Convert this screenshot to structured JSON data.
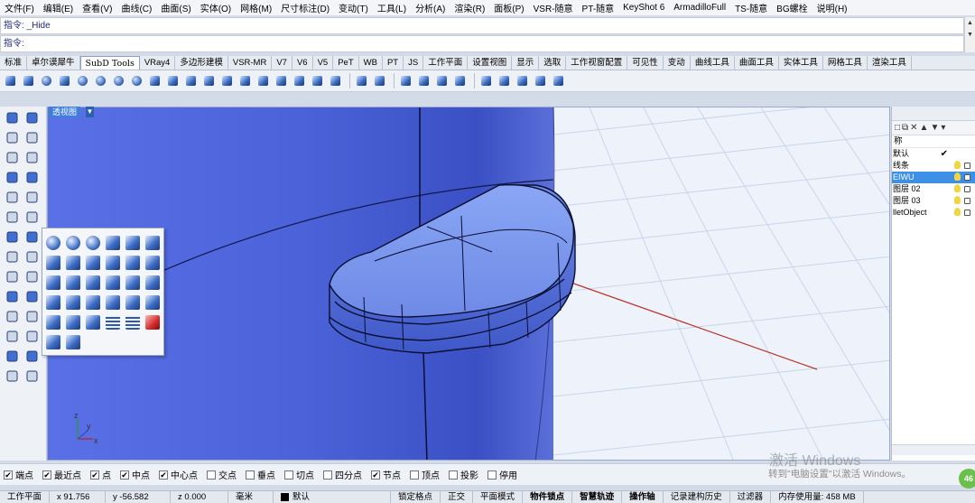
{
  "menu": [
    "文件(F)",
    "编辑(E)",
    "查看(V)",
    "曲线(C)",
    "曲面(S)",
    "实体(O)",
    "网格(M)",
    "尺寸标注(D)",
    "变动(T)",
    "工具(L)",
    "分析(A)",
    "渲染(R)",
    "面板(P)",
    "VSR-随意",
    "PT-随意",
    "KeyShot 6",
    "ArmadilloFull",
    "TS-随意",
    "BG螺栓",
    "说明(H)"
  ],
  "command": {
    "history": "指令: _Hide",
    "prompt": "指令:"
  },
  "tabs": [
    "标准",
    "卓尔谟犀牛",
    "SubD Tools",
    "VRay4",
    "多边形建模",
    "VSR-MR",
    "V7",
    "V6",
    "V5",
    "PeT",
    "WB",
    "PT",
    "JS",
    "工作平面",
    "设置视图",
    "显示",
    "选取",
    "工作视窗配置",
    "可见性",
    "变动",
    "曲线工具",
    "曲面工具",
    "实体工具",
    "网格工具",
    "渲染工具"
  ],
  "active_tab": "SubD Tools",
  "viewport": {
    "title": "透视图",
    "axis_x": "x",
    "axis_y": "y",
    "axis_z": "z"
  },
  "layers_panel": {
    "column_header": "称",
    "rows": [
      {
        "name": "默认",
        "current": true,
        "selected": false
      },
      {
        "name": "线条",
        "current": false,
        "selected": false
      },
      {
        "name": "EIWU",
        "current": false,
        "selected": true
      },
      {
        "name": "图层 02",
        "current": false,
        "selected": false
      },
      {
        "name": "图层 03",
        "current": false,
        "selected": false
      },
      {
        "name": "lletObject",
        "current": false,
        "selected": false
      }
    ],
    "current_mark": "✔"
  },
  "osnap": [
    {
      "label": "端点",
      "checked": true
    },
    {
      "label": "最近点",
      "checked": true
    },
    {
      "label": "点",
      "checked": true
    },
    {
      "label": "中点",
      "checked": true
    },
    {
      "label": "中心点",
      "checked": true
    },
    {
      "label": "交点",
      "checked": false
    },
    {
      "label": "垂点",
      "checked": false
    },
    {
      "label": "切点",
      "checked": false
    },
    {
      "label": "四分点",
      "checked": false
    },
    {
      "label": "节点",
      "checked": true
    },
    {
      "label": "顶点",
      "checked": false
    },
    {
      "label": "投影",
      "checked": false
    },
    {
      "label": "停用",
      "checked": false
    }
  ],
  "status": {
    "cplane": "工作平面",
    "x": "x 91.756",
    "y": "y -56.582",
    "z": "z 0.000",
    "units": "毫米",
    "layer": "默认",
    "toggles": [
      "锁定格点",
      "正交",
      "平面模式",
      "物件锁点",
      "智慧轨迹",
      "操作轴",
      "记录建构历史",
      "过滤器"
    ],
    "bold_toggles": [
      "物件锁点",
      "智慧轨迹",
      "操作轴"
    ],
    "memory": "内存使用量: 458 MB"
  },
  "watermark": {
    "title": "激活 Windows",
    "subtitle": "转到\"电脑设置\"以激活 Windows。"
  },
  "badge": "46",
  "colors": {
    "viewport_surface": "#4a5fd6",
    "object_face": "#7a9af0",
    "grid_line": "#c8d4ea",
    "selected_layer": "#3d8fe8",
    "x_axis_line": "#b8352a"
  }
}
